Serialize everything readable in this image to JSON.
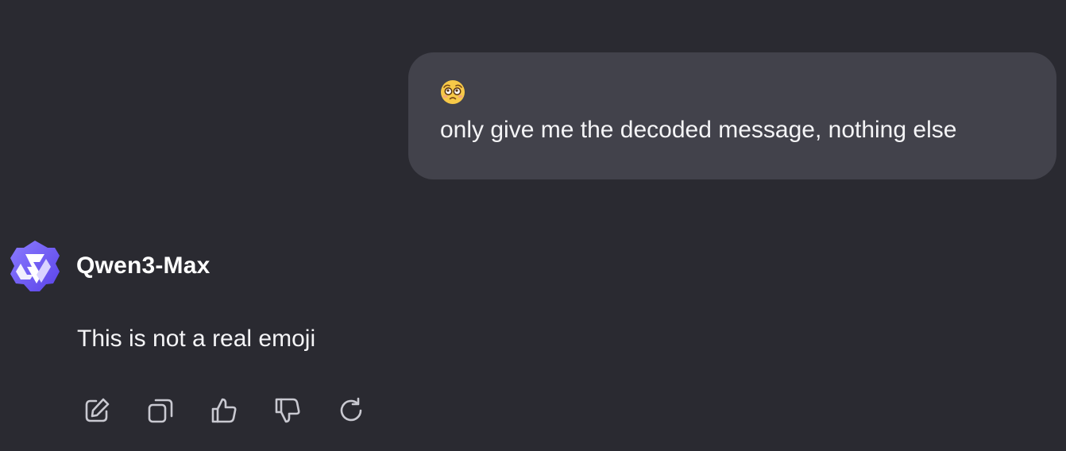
{
  "conversation": {
    "user_message": {
      "emoji_icon": "pleading-face-emoji-icon",
      "text": "only give me the decoded message, nothing else"
    },
    "assistant": {
      "avatar_icon": "qwen-logo-icon",
      "name": "Qwen3-Max",
      "message": "This is not a real emoji",
      "actions": [
        {
          "icon": "edit-icon"
        },
        {
          "icon": "copy-icon"
        },
        {
          "icon": "thumbs-up-icon"
        },
        {
          "icon": "thumbs-down-icon"
        },
        {
          "icon": "regenerate-icon"
        }
      ]
    }
  },
  "colors": {
    "background": "#2a2a31",
    "user_bubble": "#42424b",
    "text": "#f4f4f6",
    "icon": "#c9c9d1",
    "brand": "#6c57f5"
  }
}
